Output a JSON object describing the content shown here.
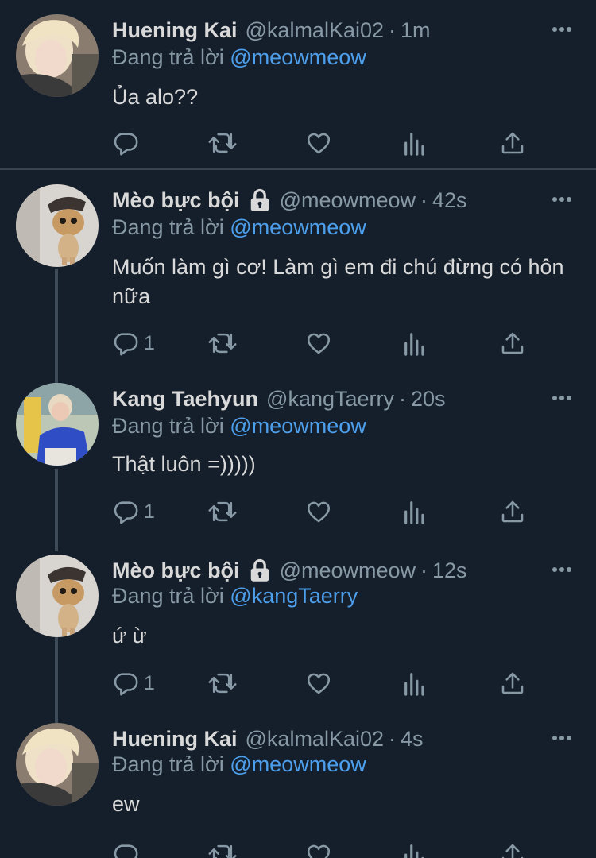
{
  "colors": {
    "background": "#151f2b",
    "text_primary": "#d9d9d9",
    "text_secondary": "#8899a6",
    "mention": "#4d9fec",
    "divider": "#38444d",
    "thread_line": "#3d4a57"
  },
  "reply_prefix": "Đang trả lời",
  "tweets": [
    {
      "name": "Huening Kai",
      "handle": "@kalmalKai02",
      "dot": "·",
      "time": "1m",
      "protected": false,
      "reply_to": "@meowmeow",
      "text": "Ủa alo??",
      "reply_count": "",
      "avatar": "portrait of blond person"
    },
    {
      "name": "Mèo bực bội",
      "handle": "@meowmeow",
      "dot": "·",
      "time": "42s",
      "protected": true,
      "reply_to": "@meowmeow",
      "text": "Muốn làm gì cơ! Làm gì em đi chú đừng có hôn nữa",
      "reply_count": "1",
      "avatar": "cat in a hat"
    },
    {
      "name": "Kang Taehyun",
      "handle": "@kangTaerry",
      "dot": "·",
      "time": "20s",
      "protected": false,
      "reply_to": "@meowmeow",
      "text": "Thật luôn =)))))",
      "reply_count": "1",
      "avatar": "person in blue sweater"
    },
    {
      "name": "Mèo bực bội",
      "handle": "@meowmeow",
      "dot": "·",
      "time": "12s",
      "protected": true,
      "reply_to": "@kangTaerry",
      "text": "ứ ừ",
      "reply_count": "1",
      "avatar": "cat in a hat"
    },
    {
      "name": "Huening Kai",
      "handle": "@kalmalKai02",
      "dot": "·",
      "time": "4s",
      "protected": false,
      "reply_to": "@meowmeow",
      "text": "ew",
      "reply_count": "",
      "avatar": "portrait of blond person"
    }
  ],
  "icons": {
    "reply": "reply-icon",
    "retweet": "retweet-icon",
    "like": "heart-icon",
    "analytics": "analytics-icon",
    "share": "share-icon",
    "more": "more-icon",
    "lock": "lock-icon"
  }
}
